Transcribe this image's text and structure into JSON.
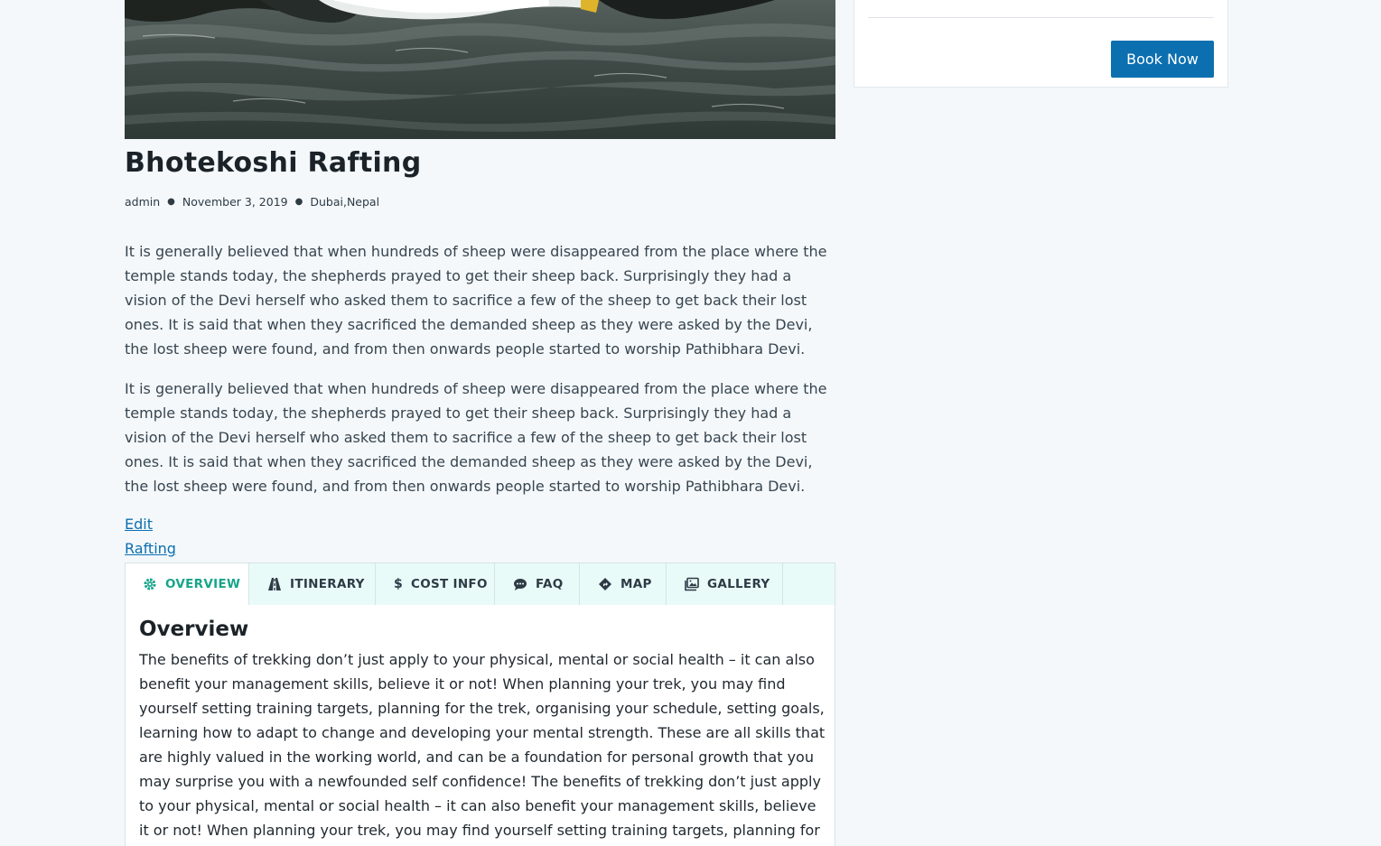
{
  "sidebar": {
    "book_label": "Book Now"
  },
  "post": {
    "title": "Bhotekoshi Rafting",
    "author": "admin",
    "date": "November 3, 2019",
    "locations": "Dubai,Nepal",
    "paragraphs": [
      "It is generally believed that when hundreds of sheep were disappeared from the place where the temple stands today, the shepherds prayed to get their sheep back. Surprisingly they had a vision of the Devi herself who asked them to sacrifice a few of the sheep to get back their lost ones. It is said that when they sacrificed the demanded sheep as they were asked by the Devi, the lost sheep were found, and from then onwards people started to worship Pathibhara Devi.",
      "It is generally believed that when hundreds of sheep were disappeared from the place where the temple stands today, the shepherds prayed to get their sheep back. Surprisingly they had a vision of the Devi herself who asked them to sacrifice a few of the sheep to get back their lost ones. It is said that when they sacrificed the demanded sheep as they were asked by the Devi, the lost sheep were found, and from then onwards people started to worship Pathibhara Devi."
    ],
    "edit_link": "Edit",
    "category_link": "Rafting"
  },
  "tabs": [
    {
      "label": "OVERVIEW",
      "icon": "gear-icon"
    },
    {
      "label": "ITINERARY",
      "icon": "road-icon"
    },
    {
      "label": "COST INFO",
      "icon": "dollar-icon"
    },
    {
      "label": "FAQ",
      "icon": "comment-icon"
    },
    {
      "label": "MAP",
      "icon": "directions-icon"
    },
    {
      "label": "GALLERY",
      "icon": "images-icon"
    }
  ],
  "overview": {
    "heading": "Overview",
    "text": "The benefits of trekking don’t just apply to your physical, mental or social health – it can also benefit your management skills, believe it or not! When planning your trek, you may find yourself setting training targets, planning for the trek, organising your schedule, setting goals, learning how to adapt to change and developing your mental strength. These are all skills that are highly valued in the working world, and can be a foundation for personal growth that you may surprise you with a newfounded self confidence! The benefits of trekking don’t just apply to your physical, mental or social health – it can also benefit your management skills, believe it or not! When planning your trek, you may find yourself setting training targets, planning for the trek, organising"
  },
  "colors": {
    "accent": "#0c6fb0",
    "active_tab": "#17a589",
    "tab_bar_bg": "#e9fbf9",
    "page_bg": "#f4f8fb"
  }
}
